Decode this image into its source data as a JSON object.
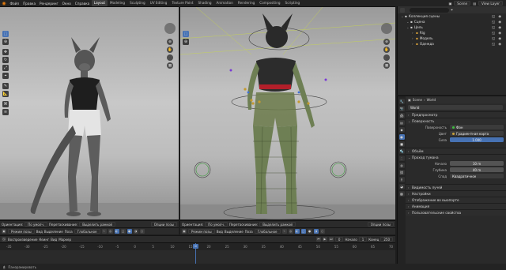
{
  "topbar": {
    "menus": [
      "Файл",
      "Правка",
      "Рендеринг",
      "Окно",
      "Справка"
    ],
    "workspaces": [
      "Layout",
      "Modeling",
      "Sculpting",
      "UV Editing",
      "Texture Paint",
      "Shading",
      "Animation",
      "Rendering",
      "Compositing",
      "Scripting"
    ],
    "active_workspace": "Layout",
    "scene": "Scene",
    "view_layer": "View Layer"
  },
  "viewport_left": {
    "header_items": [
      "Ориентация:",
      "По умолч.",
      "Перетаскивание:",
      "Выделить рамкой"
    ],
    "mode": "Режим позы",
    "menus": [
      "Вид",
      "Выделение",
      "Поза"
    ],
    "pivot": "Глобальное",
    "options": "Опции позы"
  },
  "viewport_right": {
    "header_items": [
      "Ориентация:",
      "По умолч.",
      "Перетаскивание:",
      "Выделить рамкой"
    ],
    "mode": "Режим позы",
    "menus": [
      "Вид",
      "Выделение",
      "Поза"
    ],
    "pivot": "Глобальное",
    "options": "Опции позы"
  },
  "timeline": {
    "menus": [
      "Воспроизведение",
      "Кеинг",
      "Вид",
      "Маркер"
    ],
    "ticks": [
      "-35",
      "-30",
      "-25",
      "-20",
      "-15",
      "-10",
      "-5",
      "0",
      "5",
      "10",
      "15",
      "20",
      "25",
      "30",
      "35",
      "40",
      "45",
      "50",
      "55",
      "60",
      "65",
      "70"
    ],
    "current_frame": "0",
    "start_label": "Начало",
    "start": "1",
    "end_label": "Конец",
    "end": "250"
  },
  "statusbar": {
    "item": "Панорамировать"
  },
  "outliner": {
    "title": "Коллекция сцены",
    "rows": [
      {
        "label": "Коллекция сцены",
        "indent": 0
      },
      {
        "label": "Сцена",
        "indent": 1
      },
      {
        "label": "Цель",
        "indent": 1
      },
      {
        "label": "Rig",
        "indent": 2
      },
      {
        "label": "Модель",
        "indent": 2
      },
      {
        "label": "Одежда",
        "indent": 2
      }
    ]
  },
  "properties": {
    "breadcrumb_scene": "Scene",
    "breadcrumb_world": "World",
    "world_name": "World",
    "sections": {
      "preview": "Предпросмотр",
      "surface": "Поверхность",
      "volume": "Объём",
      "mist": "Проход тумана",
      "ray_visibility": "Видимость лучей",
      "settings": "Настройки",
      "viewport_display": "Отображение во вьюпорте",
      "animation": "Анимация",
      "custom_props": "Пользовательские свойства"
    },
    "surface_label": "Поверхность",
    "surface_value": "Фон",
    "color_label": "Цвет",
    "color_value": "Градиентная карта",
    "strength_label": "Сила",
    "strength_value": "1.000",
    "mist_start_label": "Начало",
    "mist_start": "10 m",
    "mist_depth_label": "Глубина",
    "mist_depth": "40 m",
    "falloff_label": "Спад",
    "falloff_value": "Квадратичное"
  }
}
